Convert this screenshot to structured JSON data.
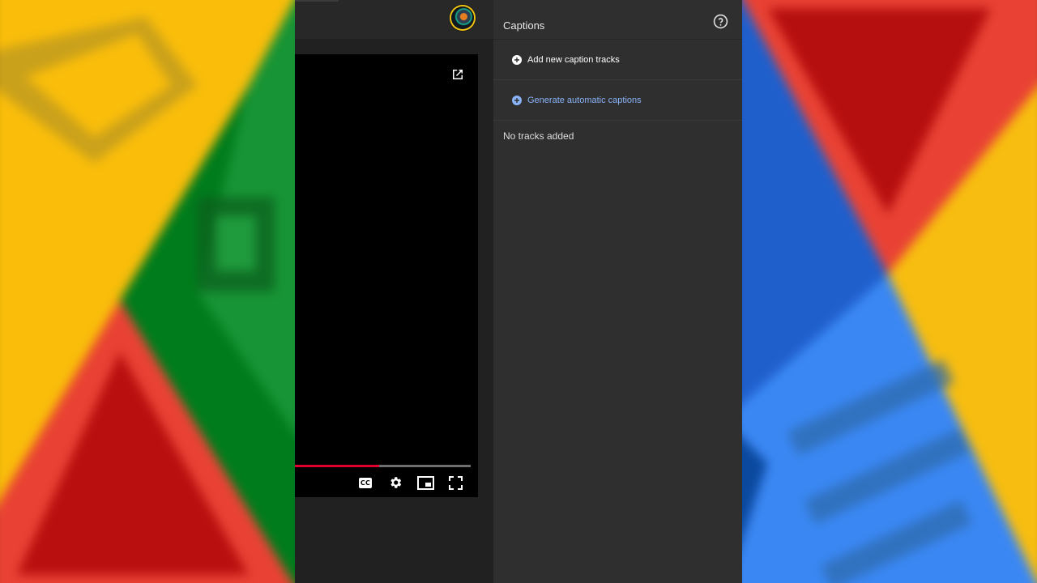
{
  "captions_panel": {
    "title": "Captions",
    "help_icon": "help-circle-icon",
    "add_tracks_label": "Add new caption tracks",
    "generate_label": "Generate automatic captions",
    "empty_message": "No tracks added"
  },
  "player": {
    "progress": 0.48,
    "icons": [
      "open-in-new-icon",
      "closed-captions-icon",
      "settings-gear-icon",
      "miniplayer-icon",
      "fullscreen-icon"
    ]
  },
  "colors": {
    "panel_bg": "#2f2f2f",
    "accent_blue": "#8ab4f8",
    "progress_red": "#e1002d",
    "text_primary": "#e9e9e9"
  }
}
